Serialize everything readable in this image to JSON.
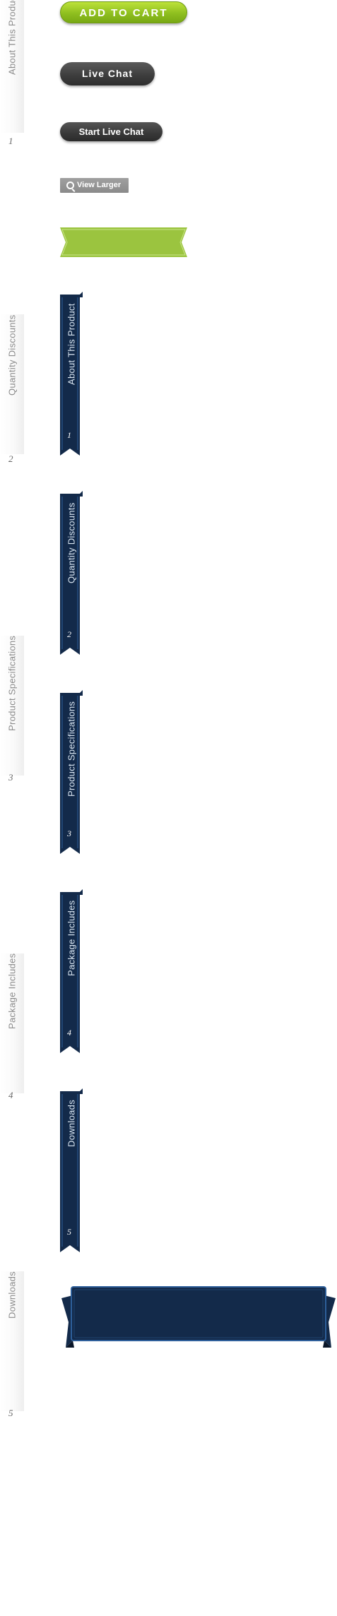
{
  "buttons": {
    "add_to_cart": "ADD TO CART",
    "live_chat": "Live Chat",
    "start_live_chat": "Start Live Chat",
    "view_larger": "View Larger"
  },
  "side_tabs": [
    {
      "label": "About This Product",
      "number": "1"
    },
    {
      "label": "Quantity Discounts",
      "number": "2"
    },
    {
      "label": "Product Specifications",
      "number": "3"
    },
    {
      "label": "Package Includes",
      "number": "4"
    },
    {
      "label": "Downloads",
      "number": "5"
    }
  ],
  "ribbons": [
    {
      "label": "About This Product",
      "number": "1"
    },
    {
      "label": "Quantity Discounts",
      "number": "2"
    },
    {
      "label": "Product Specifications",
      "number": "3"
    },
    {
      "label": "Package Includes",
      "number": "4"
    },
    {
      "label": "Downloads",
      "number": "5"
    }
  ],
  "colors": {
    "cart_green": "#8fbf1f",
    "banner_green": "#9bc43f",
    "ribbon_navy": "#132a4a",
    "ribbon_edge": "#2e5f9a",
    "chat_dark": "#3c3c3c",
    "tab_text": "#8a8a8a"
  }
}
